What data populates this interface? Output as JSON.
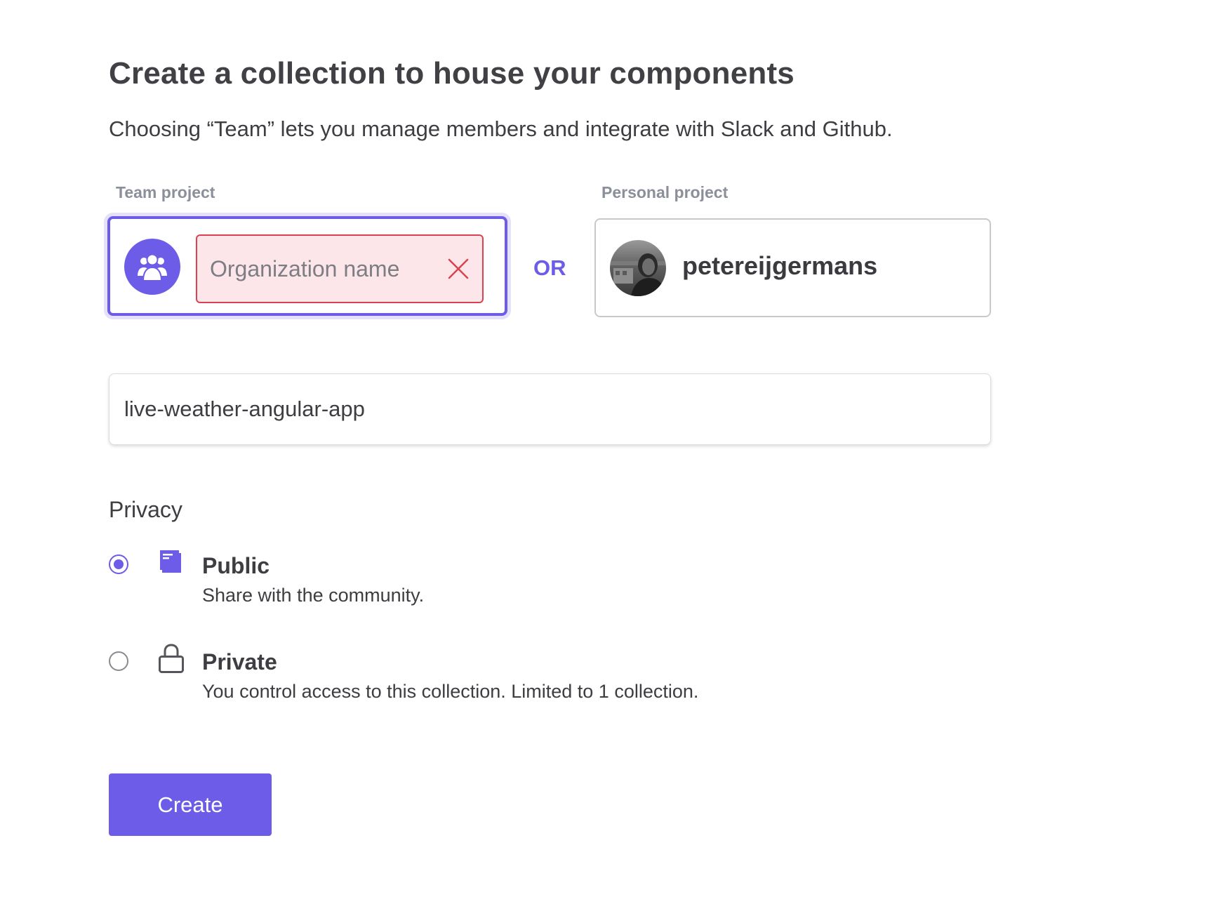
{
  "page": {
    "title": "Create a collection to house your components",
    "subtitle": "Choosing “Team” lets you manage members and integrate with Slack and Github."
  },
  "team": {
    "label": "Team project",
    "org_placeholder": "Organization name",
    "org_value": ""
  },
  "divider": "OR",
  "personal": {
    "label": "Personal project",
    "username": "petereijgermans"
  },
  "collection": {
    "name_value": "live-weather-angular-app"
  },
  "privacy": {
    "heading": "Privacy",
    "options": [
      {
        "title": "Public",
        "description": "Share with the community.",
        "icon": "book-icon",
        "selected": true
      },
      {
        "title": "Private",
        "description": "You control access to this collection. Limited to 1 collection.",
        "icon": "lock-icon",
        "selected": false
      }
    ]
  },
  "actions": {
    "create_label": "Create"
  },
  "colors": {
    "accent": "#6c5ce7",
    "error_border": "#d9434f",
    "error_background": "#fce6e9",
    "muted_label": "#8a8f99"
  }
}
